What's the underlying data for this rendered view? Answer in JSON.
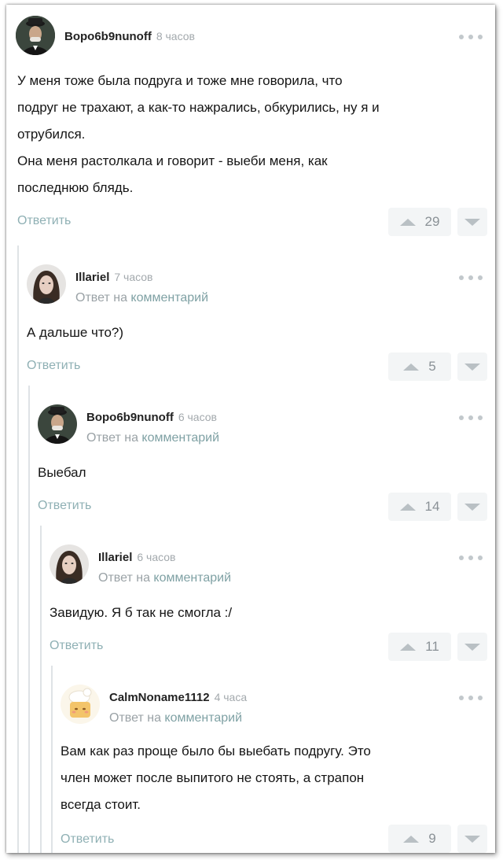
{
  "comments": [
    {
      "author": "Bopo6b9nunoff",
      "time": "8 часов",
      "reply_prefix": "",
      "reply_link": "",
      "lines": [
        "У меня тоже была подруга и тоже мне говорила, что",
        "подруг не трахают, а как-то нажрались, обкурились, ну я и",
        "отрубился.",
        "Она меня растолкала и говорит - выеби меня, как",
        "последнюю блядь."
      ],
      "reply_label": "Ответить",
      "rating": "29"
    },
    {
      "author": "Illariel",
      "time": "7 часов",
      "reply_prefix": "Ответ на",
      "reply_link": "комментарий",
      "lines": [
        "А дальше что?)"
      ],
      "reply_label": "Ответить",
      "rating": "5"
    },
    {
      "author": "Bopo6b9nunoff",
      "time": "6 часов",
      "reply_prefix": "Ответ на",
      "reply_link": "комментарий",
      "lines": [
        "Выебал"
      ],
      "reply_label": "Ответить",
      "rating": "14"
    },
    {
      "author": "Illariel",
      "time": "6 часов",
      "reply_prefix": "Ответ на",
      "reply_link": "комментарий",
      "lines": [
        "Завидую. Я б так не смогла :/"
      ],
      "reply_label": "Ответить",
      "rating": "11"
    },
    {
      "author": "CalmNoname1112",
      "time": "4 часа",
      "reply_prefix": "Ответ на",
      "reply_link": "комментарий",
      "lines": [
        "Вам как раз проще было бы выебать подругу. Это",
        "член может после выпитого не стоять, а страпон",
        "всегда стоит."
      ],
      "reply_label": "Ответить",
      "rating": "9"
    }
  ],
  "icons": {
    "more": "three-dots-icon",
    "upvote": "triangle-up-icon",
    "downvote": "triangle-down-icon"
  },
  "colors": {
    "link": "#7fa1a4",
    "reply_button": "#8fb0b4",
    "meta": "#a3a9ad",
    "thread_line": "#dfe3e6",
    "vote_bg": "#f3f5f6"
  }
}
